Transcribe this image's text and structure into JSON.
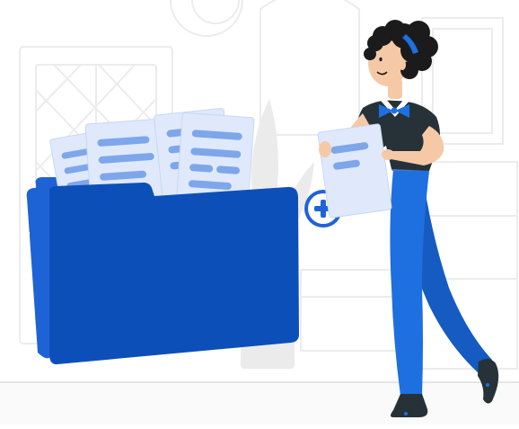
{
  "illustration": {
    "subject": "woman-adding-document-to-folder",
    "colors": {
      "background": "#ffffff",
      "background_sketch": "#ececec",
      "background_sketch_dark": "#e0e0e0",
      "floor_line": "#e6e6e6",
      "plant": "#ebebeb",
      "folder_back": "#1e63d6",
      "folder_front": "#0d4fb8",
      "folder_front_shade": "#0a47a8",
      "paper": "#dfe9fb",
      "paper_outline": "#c8d8f5",
      "paper_lines": "#7ea6ea",
      "plus_badge": "#1e63d6",
      "shirt": "#263238",
      "trousers": "#1e6fe0",
      "trousers_shade": "#155bc2",
      "skin": "#f6c9a6",
      "hair": "#1b1b1b",
      "headband": "#1e6fe0",
      "bowtie": "#1e6fe0",
      "shoes": "#263238",
      "belt": "#4a78c9"
    },
    "icons": [
      "plus-circle-icon",
      "folder-icon",
      "document-icon"
    ]
  }
}
